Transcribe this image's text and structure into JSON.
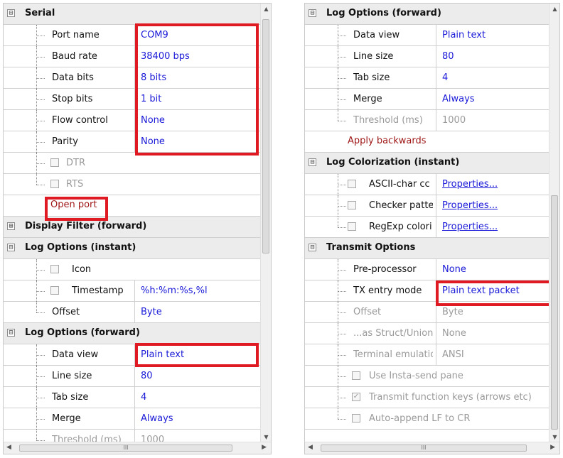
{
  "left": {
    "serial": {
      "header": "Serial",
      "toggle": "⊟",
      "port_name": {
        "name": "Port name",
        "value": "COM9"
      },
      "baud_rate": {
        "name": "Baud rate",
        "value": "38400 bps"
      },
      "data_bits": {
        "name": "Data bits",
        "value": "8 bits"
      },
      "stop_bits": {
        "name": "Stop bits",
        "value": "1 bit"
      },
      "flow_control": {
        "name": "Flow control",
        "value": "None"
      },
      "parity": {
        "name": "Parity",
        "value": "None"
      },
      "dtr": "DTR",
      "rts": "RTS",
      "open_port": "Open port"
    },
    "display_filter": {
      "header": "Display Filter (forward)",
      "toggle": "⊞"
    },
    "log_instant": {
      "header": "Log Options (instant)",
      "toggle": "⊟",
      "icon": "Icon",
      "timestamp": {
        "name": "Timestamp",
        "value": "%h:%m:%s,%l"
      },
      "offset": {
        "name": "Offset",
        "value": "Byte"
      }
    },
    "log_forward": {
      "header": "Log Options (forward)",
      "toggle": "⊟",
      "data_view": {
        "name": "Data view",
        "value": "Plain text"
      },
      "line_size": {
        "name": "Line size",
        "value": "80"
      },
      "tab_size": {
        "name": "Tab size",
        "value": "4"
      },
      "merge": {
        "name": "Merge",
        "value": "Always"
      },
      "threshold": {
        "name": "Threshold (ms)",
        "value": "1000"
      }
    },
    "hscroll_grip": "III"
  },
  "right": {
    "log_forward": {
      "header": "Log Options (forward)",
      "toggle": "⊟",
      "data_view": {
        "name": "Data view",
        "value": "Plain text"
      },
      "line_size": {
        "name": "Line size",
        "value": "80"
      },
      "tab_size": {
        "name": "Tab size",
        "value": "4"
      },
      "merge": {
        "name": "Merge",
        "value": "Always"
      },
      "threshold": {
        "name": "Threshold (ms)",
        "value": "1000"
      },
      "apply_backwards": "Apply backwards"
    },
    "log_colorization": {
      "header": "Log Colorization (instant)",
      "toggle": "⊟",
      "ascii": {
        "name": "ASCII-char cc",
        "value": "Properties..."
      },
      "checker": {
        "name": "Checker patte",
        "value": "Properties..."
      },
      "regexp": {
        "name": "RegExp colori",
        "value": "Properties..."
      }
    },
    "transmit": {
      "header": "Transmit Options",
      "toggle": "⊟",
      "preprocessor": {
        "name": "Pre-processor",
        "value": "None"
      },
      "tx_entry_mode": {
        "name": "TX entry mode",
        "value": "Plain text packet"
      },
      "offset": {
        "name": "Offset",
        "value": "Byte"
      },
      "as_struct": {
        "name": "...as Struct/Union",
        "value": "None"
      },
      "terminal": {
        "name": "Terminal emulatio",
        "value": "ANSI"
      },
      "insta_send": "Use Insta-send pane",
      "fkeys": "Transmit function keys (arrows etc)",
      "auto_lf": "Auto-append LF to CR"
    },
    "hscroll_grip": "III"
  },
  "colors": {
    "highlight": "#e01a22",
    "value_text": "#1a1ad8",
    "action_text": "#a01818"
  }
}
